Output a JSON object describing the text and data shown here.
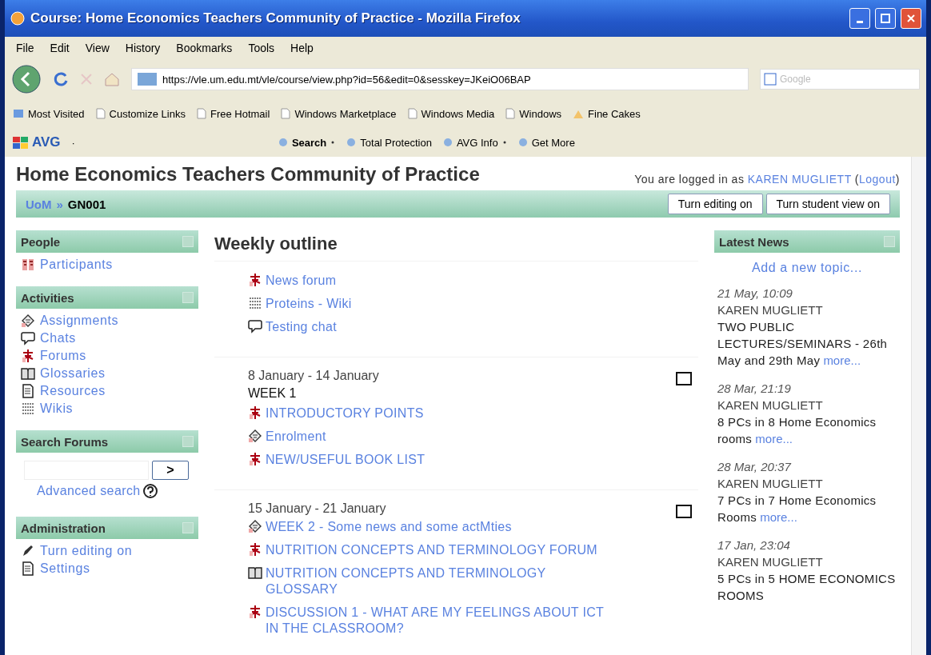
{
  "window": {
    "title": "Course: Home Economics Teachers Community of Practice - Mozilla Firefox"
  },
  "menu": [
    "File",
    "Edit",
    "View",
    "History",
    "Bookmarks",
    "Tools",
    "Help"
  ],
  "address": {
    "url": "https://vle.um.edu.mt/vle/course/view.php?id=56&edit=0&sesskey=JKeiO06BAP"
  },
  "search": {
    "placeholder": "Google"
  },
  "bookmarks": [
    {
      "label": "Most Visited",
      "kind": "special"
    },
    {
      "label": "Customize Links",
      "kind": "page"
    },
    {
      "label": "Free Hotmail",
      "kind": "page"
    },
    {
      "label": "Windows Marketplace",
      "kind": "page"
    },
    {
      "label": "Windows Media",
      "kind": "page"
    },
    {
      "label": "Windows",
      "kind": "page"
    },
    {
      "label": "Fine Cakes",
      "kind": "feed"
    }
  ],
  "avg": {
    "logo": "AVG",
    "caret": "·",
    "items": [
      {
        "label": "Search",
        "bold": true,
        "dropdown": true
      },
      {
        "label": "Total Protection",
        "bold": false,
        "dropdown": false
      },
      {
        "label": "AVG Info",
        "bold": false,
        "dropdown": true
      },
      {
        "label": "Get More",
        "bold": false,
        "dropdown": false
      }
    ]
  },
  "page": {
    "title": "Home Economics Teachers Community of Practice",
    "login": {
      "prefix": "You are logged in as",
      "user": "KAREN MUGLIETT",
      "open": "(",
      "logout": "Logout",
      "close": ")"
    },
    "breadcrumb": {
      "home": "UoM",
      "separator": "»",
      "current": "GN001"
    },
    "buttons": [
      "Turn editing on",
      "Turn student view on"
    ],
    "left_blocks": [
      {
        "title": "People",
        "kind": "links",
        "items": [
          {
            "label": "Participants",
            "kind": "people"
          }
        ]
      },
      {
        "title": "Activities",
        "kind": "links",
        "items": [
          {
            "label": "Assignments",
            "kind": "assignment"
          },
          {
            "label": "Chats",
            "kind": "chat"
          },
          {
            "label": "Forums",
            "kind": "forum"
          },
          {
            "label": "Glossaries",
            "kind": "glossary"
          },
          {
            "label": "Resources",
            "kind": "resource"
          },
          {
            "label": "Wikis",
            "kind": "wiki"
          }
        ]
      },
      {
        "title": "Search Forums",
        "kind": "search",
        "button": ">",
        "link": "Advanced search"
      },
      {
        "title": "Administration",
        "kind": "links",
        "items": [
          {
            "label": "Turn editing on",
            "kind": "edit"
          },
          {
            "label": "Settings",
            "kind": "resource"
          }
        ]
      }
    ],
    "outline": {
      "title": "Weekly outline",
      "sections": [
        {
          "items": [
            {
              "label": "News forum",
              "kind": "forum"
            },
            {
              "label": "Proteins - Wiki",
              "kind": "wiki"
            },
            {
              "label": "Testing chat",
              "kind": "chat"
            }
          ]
        },
        {
          "dates": "8 January - 14 January",
          "heading": "WEEK 1",
          "items": [
            {
              "label": "INTRODUCTORY POINTS",
              "kind": "forum"
            },
            {
              "label": "Enrolment",
              "kind": "assignment"
            },
            {
              "label": "NEW/USEFUL BOOK LIST",
              "kind": "forum"
            }
          ]
        },
        {
          "dates": "15 January - 21 January",
          "items": [
            {
              "label": "WEEK 2 - Some news and some actMties",
              "kind": "assignment"
            },
            {
              "label": "NUTRITION CONCEPTS AND TERMINOLOGY FORUM",
              "kind": "forum"
            },
            {
              "label": "NUTRITION CONCEPTS AND TERMINOLOGY GLOSSARY",
              "kind": "glossary"
            },
            {
              "label": "DISCUSSION 1 - WHAT ARE MY FEELINGS ABOUT ICT IN THE CLASSROOM?",
              "kind": "forum"
            }
          ]
        }
      ]
    },
    "news": {
      "title": "Latest News",
      "add": "Add a new topic...",
      "posts": [
        {
          "date": "21 May, 10:09",
          "author": "KAREN MUGLIETT",
          "subject": "TWO PUBLIC LECTURES/SEMINARS - 26th May and 29th May",
          "more": "more..."
        },
        {
          "date": "28 Mar, 21:19",
          "author": "KAREN MUGLIETT",
          "subject": "8 PCs in 8 Home Economics rooms",
          "more": "more..."
        },
        {
          "date": "28 Mar, 20:37",
          "author": "KAREN MUGLIETT",
          "subject": "7 PCs in 7 Home Economics Rooms",
          "more": "more..."
        },
        {
          "date": "17 Jan, 23:04",
          "author": "KAREN MUGLIETT",
          "subject": "5 PCs in 5 HOME ECONOMICS ROOMS"
        }
      ]
    }
  }
}
